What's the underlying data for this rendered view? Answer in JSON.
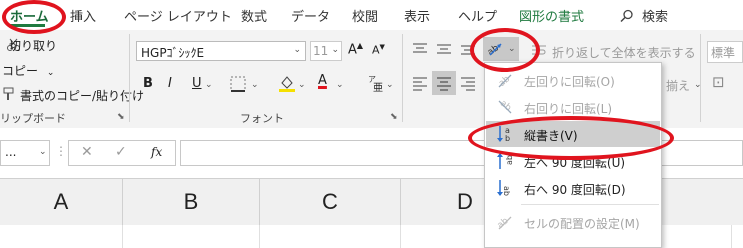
{
  "tabs": [
    {
      "label": "ホーム",
      "active": true
    },
    {
      "label": "挿入"
    },
    {
      "label": "ページ レイアウト"
    },
    {
      "label": "数式"
    },
    {
      "label": "データ"
    },
    {
      "label": "校閲"
    },
    {
      "label": "表示"
    },
    {
      "label": "ヘルプ"
    },
    {
      "label": "図形の書式"
    }
  ],
  "search_label": "検索",
  "clipboard": {
    "cut": "切り取り",
    "copy": "コピー",
    "format_painter": "書式のコピー/貼り付け",
    "group": "リップボード"
  },
  "font": {
    "name": "HGPｺﾞｼｯｸE",
    "size": "11",
    "grow": "A",
    "shrink": "A",
    "bold": "B",
    "italic": "I",
    "underline": "U",
    "group": "フォント"
  },
  "alignment": {
    "wrap_text": "折り返して全体を表示する",
    "merge": "揃え"
  },
  "number": {
    "format": "標準"
  },
  "name_box": "...",
  "formula": {
    "cancel": "✕",
    "enter": "✓",
    "fx": "fx"
  },
  "columns": [
    "A",
    "B",
    "C",
    "D"
  ],
  "orientation_menu": [
    {
      "label": "左回りに回転(O)",
      "disabled": true
    },
    {
      "label": "右回りに回転(L)",
      "disabled": true
    },
    {
      "label": "縦書き(V)",
      "disabled": false,
      "highlighted": true
    },
    {
      "label": "左へ 90 度回転(U)",
      "disabled": false
    },
    {
      "label": "右へ 90 度回転(D)",
      "disabled": false
    },
    {
      "label": "セルの配置の設定(M)",
      "disabled": true
    }
  ],
  "colors": {
    "accent": "#1f7a3f",
    "annotation": "#e0141e",
    "font_color": "#e0141e",
    "fill_color": "#f5e000"
  }
}
